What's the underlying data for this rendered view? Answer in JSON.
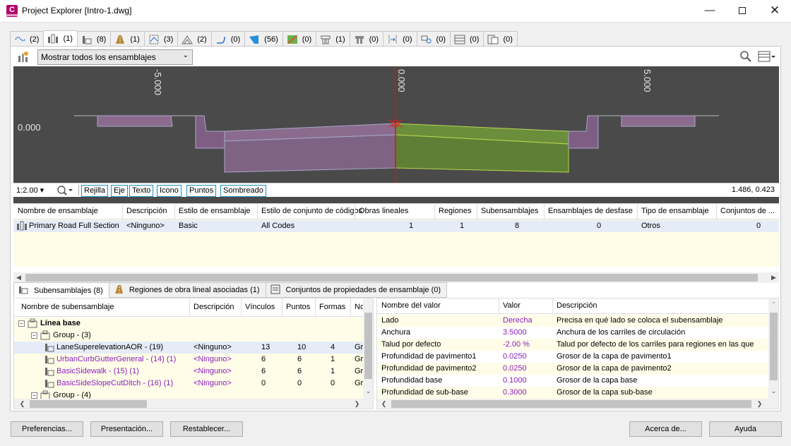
{
  "window": {
    "title": "Project Explorer [Intro-1.dwg]",
    "app_icon_letter": "C"
  },
  "top_tabs": [
    {
      "icon": "alignment-icon",
      "count": "(2)"
    },
    {
      "icon": "assembly-icon",
      "count": "(1)"
    },
    {
      "icon": "subassembly-icon",
      "count": "(8)"
    },
    {
      "icon": "corridor-icon",
      "count": "(1)"
    },
    {
      "icon": "profile-icon",
      "count": "(3)"
    },
    {
      "icon": "surface-icon",
      "count": "(2)"
    },
    {
      "icon": "feature-line-icon",
      "count": "(0)"
    },
    {
      "icon": "parcel-icon",
      "count": "(56)"
    },
    {
      "icon": "site-icon",
      "count": "(0)"
    },
    {
      "icon": "intersection-icon",
      "count": "(1)"
    },
    {
      "icon": "sample-line-icon",
      "count": "(0)"
    },
    {
      "icon": "section-view-icon",
      "count": "(0)"
    },
    {
      "icon": "pipe-network-icon",
      "count": "(0)"
    },
    {
      "icon": "table-icon",
      "count": "(0)"
    },
    {
      "icon": "catchment-icon",
      "count": "(0)"
    }
  ],
  "filter": {
    "selected": "Mostrar todos los ensamblajes"
  },
  "viewport": {
    "labels": {
      "left": "-5.000",
      "center": "0.000",
      "right": "5.000",
      "y": "0.000"
    },
    "colors": {
      "background": "#4a4a4a",
      "purple": "#8a6b8e",
      "green": "#6b8e3c",
      "centerline": "#d01818"
    }
  },
  "viewbar": {
    "scale": "1:2.00",
    "buttons": [
      "Rejilla",
      "Eje",
      "Texto",
      "Icono",
      "Puntos",
      "Sombreado"
    ],
    "coords": "1.486, 0.423"
  },
  "assemblies": {
    "headers": [
      "Nombre de ensamblaje",
      "Descripción",
      "Estilo de ensamblaje",
      "Estilo de conjunto de códigos",
      "Obras lineales",
      "Regiones",
      "Subensamblajes",
      "Ensamblajes de desfase",
      "Tipo de ensamblaje",
      "Conjuntos de ..."
    ],
    "rows": [
      [
        "Primary Road Full Section",
        "<Ninguno>",
        "Basic",
        "All Codes",
        "1",
        "1",
        "8",
        "0",
        "Otros",
        "0"
      ]
    ]
  },
  "bottom_tabs": [
    {
      "label": "Subensamblajes (8)",
      "icon": "subassembly-icon"
    },
    {
      "label": "Regiones de obra lineal asociadas (1)",
      "icon": "corridor-icon"
    },
    {
      "label": "Conjuntos de propiedades de ensamblaje (0)",
      "icon": "property-set-icon"
    }
  ],
  "subassemblies": {
    "headers": [
      "Nombre de subensamblaje",
      "Descripción",
      "Vínculos",
      "Puntos",
      "Formas",
      "No"
    ],
    "rows": [
      {
        "name": "Línea base",
        "bold": true,
        "indent": 0,
        "cells": [
          "",
          "",
          "",
          "",
          ""
        ]
      },
      {
        "name": "Group - (3)",
        "indent": 1,
        "cells": [
          "",
          "",
          "",
          "",
          ""
        ]
      },
      {
        "name": "LaneSuperelevationAOR - (19)",
        "indent": 2,
        "cells": [
          "<Ninguno>",
          "13",
          "10",
          "4",
          "Gr"
        ]
      },
      {
        "name": "UrbanCurbGutterGeneral - (14) (1)",
        "purple": true,
        "indent": 2,
        "cells": [
          "<Ninguno>",
          "6",
          "6",
          "1",
          "Gr"
        ]
      },
      {
        "name": "BasicSidewalk - (15) (1)",
        "purple": true,
        "indent": 2,
        "cells": [
          "<Ninguno>",
          "6",
          "6",
          "1",
          "Gr"
        ]
      },
      {
        "name": "BasicSideSlopeCutDitch - (16) (1)",
        "purple": true,
        "indent": 2,
        "cells": [
          "<Ninguno>",
          "0",
          "0",
          "0",
          "Gr"
        ]
      },
      {
        "name": "Group - (4)",
        "indent": 1,
        "cells": [
          "",
          "",
          "",
          "",
          ""
        ]
      }
    ]
  },
  "properties": {
    "headers": [
      "Nombre del valor",
      "Valor",
      "Descripción"
    ],
    "rows": [
      [
        "Lado",
        "Derecha",
        "Precisa en qué lado se coloca el subensamblaje"
      ],
      [
        "Anchura",
        "3.5000",
        "Anchura de los carriles de circulación"
      ],
      [
        "Talud por defecto",
        "-2.00 %",
        "Talud por defecto de los carriles para regiones en las que"
      ],
      [
        "Profundidad de pavimento1",
        "0.0250",
        "Grosor de la capa de pavimento1"
      ],
      [
        "Profundidad de pavimento2",
        "0.0250",
        "Grosor de la capa de pavimento2"
      ],
      [
        "Profundidad base",
        "0.1000",
        "Grosor de la capa base"
      ],
      [
        "Profundidad de sub-base",
        "0.3000",
        "Grosor de la capa sub-base"
      ]
    ]
  },
  "footer": {
    "preferences": "Preferencias...",
    "presentation": "Presentación...",
    "reset": "Restablecer...",
    "about": "Acerca de...",
    "help": "Ayuda"
  }
}
